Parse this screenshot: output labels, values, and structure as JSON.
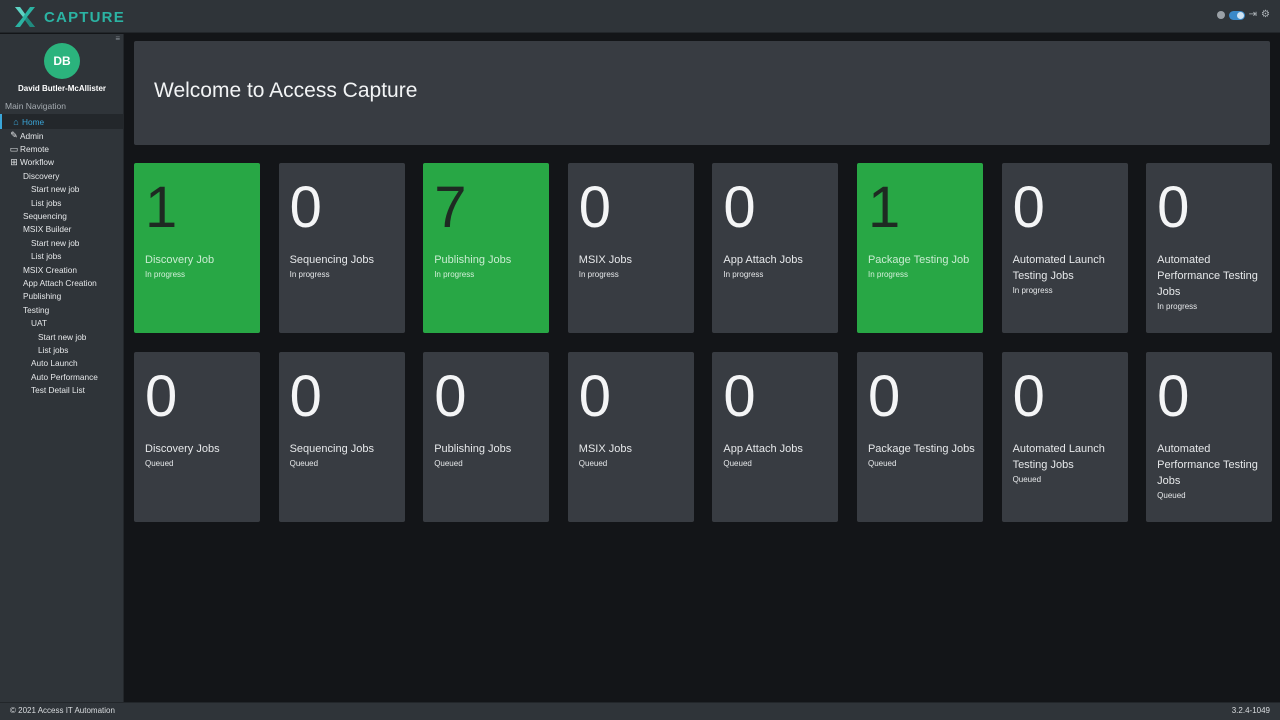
{
  "app": {
    "logo_text": "CAPTURE",
    "logo_icon": "capture-x-logo",
    "accent_color": "#2bb3a3"
  },
  "topbar": {
    "controls": [
      "status-dot-icon",
      "theme-toggle",
      "exit-icon",
      "settings-icon"
    ]
  },
  "sidebar": {
    "user_initials": "DB",
    "user_name": "David Butler-McAllister",
    "nav_heading": "Main Navigation",
    "items": [
      {
        "label": "Home",
        "icon": "home-icon",
        "active": true
      },
      {
        "label": "Admin",
        "icon": "wrench-icon"
      },
      {
        "label": "Remote",
        "icon": "monitor-icon"
      },
      {
        "label": "Workflow",
        "icon": "sitemap-icon"
      },
      {
        "label": "Discovery"
      },
      {
        "label": "Start new job"
      },
      {
        "label": "List jobs"
      },
      {
        "label": "Sequencing"
      },
      {
        "label": "MSIX Builder"
      },
      {
        "label": "Start new job"
      },
      {
        "label": "List jobs"
      },
      {
        "label": "MSIX Creation"
      },
      {
        "label": "App Attach Creation"
      },
      {
        "label": "Publishing"
      },
      {
        "label": "Testing"
      },
      {
        "label": "UAT"
      },
      {
        "label": "Start new job"
      },
      {
        "label": "List jobs"
      },
      {
        "label": "Auto Launch"
      },
      {
        "label": "Auto Performance"
      },
      {
        "label": "Test Detail List"
      }
    ]
  },
  "main": {
    "welcome_title": "Welcome to Access Capture",
    "tiles": [
      {
        "count": "1",
        "label": "Discovery Job",
        "status": "In progress",
        "highlight": true
      },
      {
        "count": "0",
        "label": "Sequencing Jobs",
        "status": "In progress",
        "highlight": false
      },
      {
        "count": "7",
        "label": "Publishing Jobs",
        "status": "In progress",
        "highlight": true
      },
      {
        "count": "0",
        "label": "MSIX Jobs",
        "status": "In progress",
        "highlight": false
      },
      {
        "count": "0",
        "label": "App Attach Jobs",
        "status": "In progress",
        "highlight": false
      },
      {
        "count": "1",
        "label": "Package Testing Job",
        "status": "In progress",
        "highlight": true
      },
      {
        "count": "0",
        "label": "Automated Launch Testing Jobs",
        "status": "In progress",
        "highlight": false
      },
      {
        "count": "0",
        "label": "Automated Performance Testing Jobs",
        "status": "In progress",
        "highlight": false
      },
      {
        "count": "0",
        "label": "Discovery Jobs",
        "status": "Queued",
        "highlight": false
      },
      {
        "count": "0",
        "label": "Sequencing Jobs",
        "status": "Queued",
        "highlight": false
      },
      {
        "count": "0",
        "label": "Publishing Jobs",
        "status": "Queued",
        "highlight": false
      },
      {
        "count": "0",
        "label": "MSIX Jobs",
        "status": "Queued",
        "highlight": false
      },
      {
        "count": "0",
        "label": "App Attach Jobs",
        "status": "Queued",
        "highlight": false
      },
      {
        "count": "0",
        "label": "Package Testing Jobs",
        "status": "Queued",
        "highlight": false
      },
      {
        "count": "0",
        "label": "Automated Launch Testing Jobs",
        "status": "Queued",
        "highlight": false
      },
      {
        "count": "0",
        "label": "Automated Performance Testing Jobs",
        "status": "Queued",
        "highlight": false
      }
    ],
    "highlight_color": "#28a745"
  },
  "footer": {
    "copyright": "© 2021 Access IT Automation",
    "version": "3.2.4-1049"
  }
}
